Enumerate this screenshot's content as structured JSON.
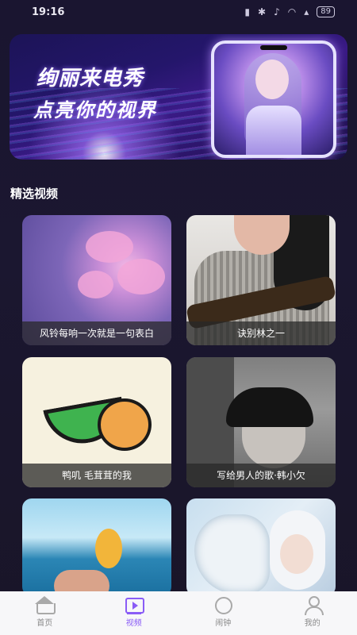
{
  "status_bar": {
    "time": "19:16",
    "battery": "89"
  },
  "banner": {
    "line1": "绚丽来电秀",
    "line2": "点亮你的视界"
  },
  "section": {
    "title": "精选视频"
  },
  "videos": [
    {
      "title": "风铃每响一次就是一句表白"
    },
    {
      "title": "诀别林之一"
    },
    {
      "title": "鸭叽 毛茸茸的我"
    },
    {
      "title": "写给男人的歌·韩小欠"
    },
    {
      "title": ""
    },
    {
      "title": ""
    }
  ],
  "tabbar": {
    "items": [
      {
        "label": "首页",
        "icon": "home-icon"
      },
      {
        "label": "视频",
        "icon": "video-icon"
      },
      {
        "label": "闹钟",
        "icon": "alarm-clock-icon"
      },
      {
        "label": "我的",
        "icon": "user-icon"
      }
    ],
    "active_index": 1,
    "active_color": "#8a5cf6"
  }
}
